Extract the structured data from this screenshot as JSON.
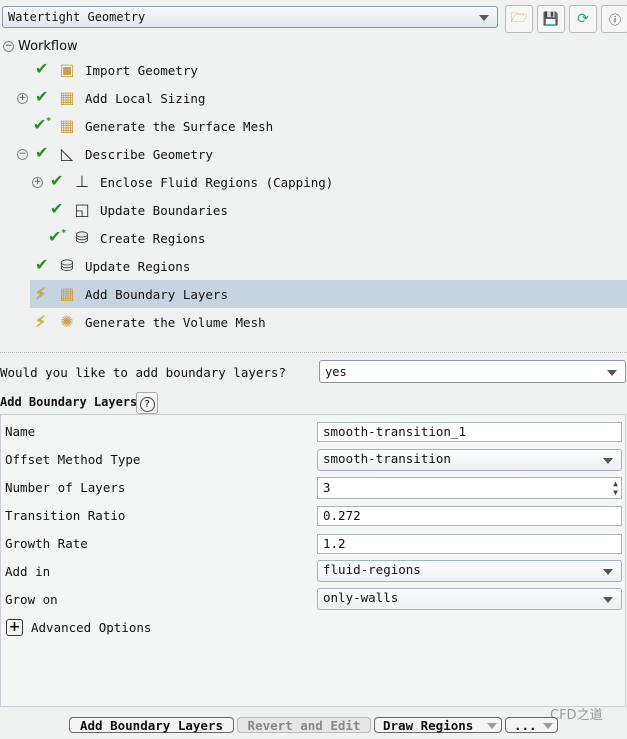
{
  "toolbar": {
    "workflow_type": "Watertight Geometry",
    "icons": [
      "open-folder-icon",
      "save-icon",
      "refresh-icon",
      "help-icon"
    ]
  },
  "tree": {
    "root": "Workflow",
    "items": [
      {
        "label": "Import Geometry",
        "status": "done"
      },
      {
        "label": "Add Local Sizing",
        "status": "done"
      },
      {
        "label": "Generate the Surface Mesh",
        "status": "done-new"
      },
      {
        "label": "Describe Geometry",
        "status": "done"
      },
      {
        "label": "Enclose Fluid Regions (Capping)",
        "status": "done"
      },
      {
        "label": "Update Boundaries",
        "status": "done"
      },
      {
        "label": "Create Regions",
        "status": "done-new"
      },
      {
        "label": "Update Regions",
        "status": "done"
      },
      {
        "label": "Add Boundary Layers",
        "status": "pending",
        "selected": true
      },
      {
        "label": "Generate the Volume Mesh",
        "status": "pending"
      }
    ]
  },
  "question": {
    "label": "Would you like to add boundary layers?",
    "value": "yes"
  },
  "section": {
    "title": "Add Boundary Layers",
    "help": "?"
  },
  "form": [
    {
      "label": "Name",
      "value": "smooth-transition_1"
    },
    {
      "label": "Offset Method Type",
      "value": "smooth-transition"
    },
    {
      "label": "Number of Layers",
      "value": "3"
    },
    {
      "label": "Transition Ratio",
      "value": "0.272"
    },
    {
      "label": "Growth Rate",
      "value": "1.2"
    },
    {
      "label": "Add in",
      "value": "fluid-regions"
    },
    {
      "label": "Grow on",
      "value": "only-walls"
    }
  ],
  "advanced": {
    "expander": "+",
    "label": "Advanced Options"
  },
  "buttons": {
    "add": "Add Boundary Layers",
    "revert": "Revert and Edit",
    "draw": "Draw Regions",
    "more": "..."
  },
  "watermark": "CFD之道"
}
